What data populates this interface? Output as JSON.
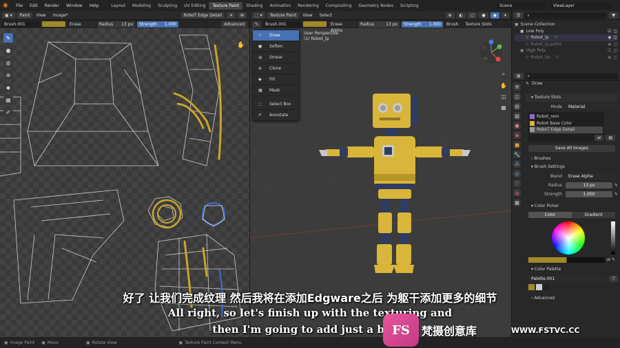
{
  "topbar": {
    "menus": [
      "File",
      "Edit",
      "Render",
      "Window",
      "Help"
    ],
    "workspaces": [
      "Layout",
      "Modeling",
      "Sculpting",
      "UV Editing",
      "Texture Paint",
      "Shading",
      "Animation",
      "Rendering",
      "Compositing",
      "Geometry Nodes",
      "Scripting"
    ],
    "scene": "Scene",
    "viewlayer": "ViewLayer"
  },
  "image_editor": {
    "mode": "Paint",
    "menus": [
      "View",
      "Image*"
    ],
    "image": "RoboT Edge Detail",
    "brush": "Brush.001",
    "blend": "Erase Alpha",
    "radius_label": "Radius",
    "radius": "13 px",
    "strength_label": "Strength",
    "strength": "1.000",
    "advanced": "Advanced"
  },
  "viewport": {
    "mode": "Texture Paint",
    "menus": [
      "View",
      "Select"
    ],
    "brush": "Brush.001",
    "blend": "Erase Alpha",
    "radius_label": "Radius",
    "radius": "13 px",
    "strength_label": "Strength",
    "strength": "1.000",
    "brush_menu": "Brush",
    "texture_slots": "Texture Slots",
    "overlay_title": "User Perspective",
    "overlay_object": "(1) Robot_lp"
  },
  "tool_menu": {
    "items": [
      "Draw",
      "Soften",
      "Smear",
      "Clone",
      "Fill",
      "Mask",
      "Select Box",
      "Annotate"
    ]
  },
  "outliner": {
    "items": [
      "Scene Collection",
      "Low Poly",
      "Robot_lp",
      "Robot_lp.paths",
      "High Poly",
      "Robot_hp"
    ]
  },
  "properties": {
    "tool_name": "Draw",
    "texture_slots_header": "Texture Slots",
    "mode_label": "Mode",
    "mode_value": "Material",
    "slots": [
      "Robot_rem",
      "Robot Base Color",
      "RoboT Edge Detail"
    ],
    "save_all": "Save All Images",
    "brushes": "Brushes",
    "brush_settings": "Brush Settings",
    "blend_label": "Blend",
    "blend_value": "Erase Alpha",
    "radius_label": "Radius",
    "radius_value": "13 px",
    "strength_label": "Strength",
    "strength_value": "1.000",
    "color_picker": "Color Picker",
    "tab_color": "Color",
    "tab_gradient": "Gradient",
    "color_palette": "Color Palette",
    "palette_name": "Palette.001",
    "advanced": "Advanced"
  },
  "statusbar": {
    "left": [
      "Image Paint",
      "Move",
      "Rotate View"
    ],
    "center": "Texture Paint Context Menu"
  },
  "subtitles": {
    "chinese": "好了 让我们完成纹理 然后我将在添加Edgware之后 为躯干添加更多的细节",
    "line1": "All right, so let's finish up with the texturing and",
    "line2": "then I'm going to add just a bit m"
  },
  "watermark": {
    "logo": "FS",
    "name": "梵摄创意库",
    "url": "WWW.FSTVC.CC"
  },
  "colors": {
    "accent": "#4772b3",
    "robot_yellow": "#d9b53a",
    "brush_color": "#a1892a"
  }
}
